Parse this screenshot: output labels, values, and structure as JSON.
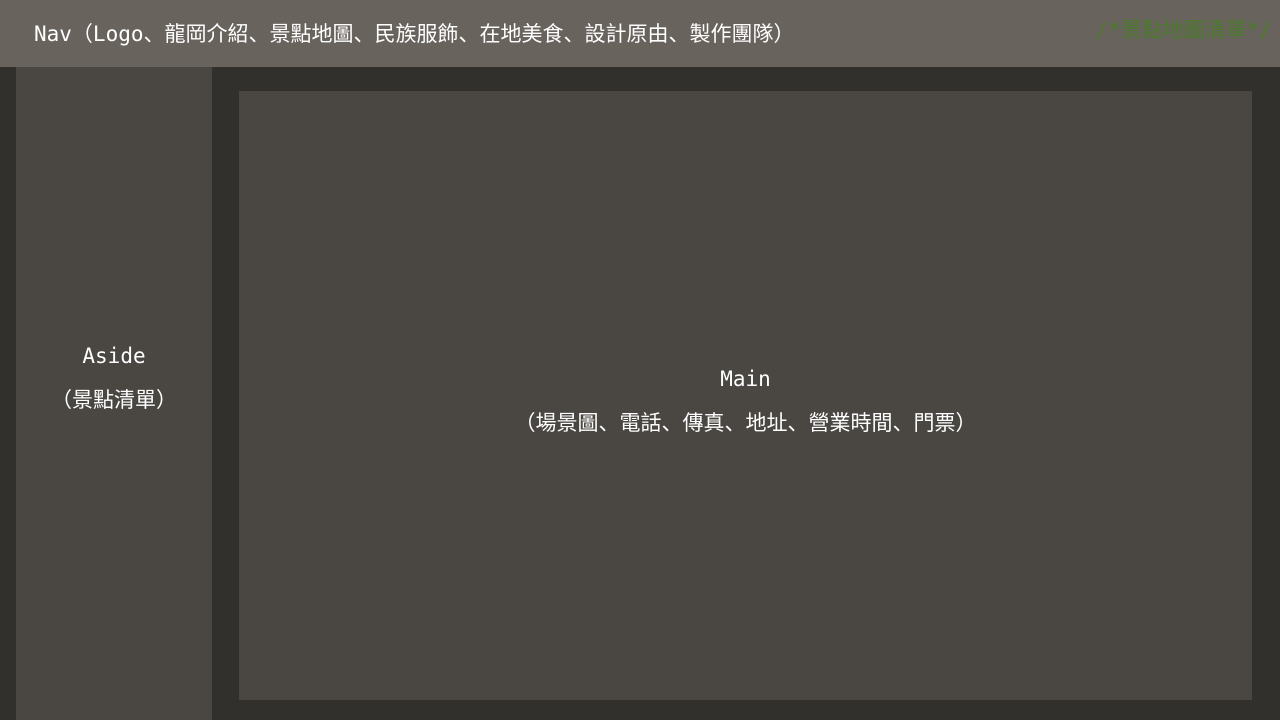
{
  "nav": {
    "label": "Nav（Logo、龍岡介紹、景點地圖、民族服飾、在地美食、設計原由、製作團隊）",
    "comment": "/*景點地圖清單*/"
  },
  "aside": {
    "title": "Aside",
    "subtitle": "（景點清單）"
  },
  "main": {
    "title": "Main",
    "subtitle": "（場景圖、電話、傳真、地址、營業時間、門票）"
  },
  "colors": {
    "background": "#32302c",
    "nav_background": "#68635d",
    "panel_background": "#4a4743",
    "text": "#ffffff",
    "comment_text": "#4c7a2c"
  }
}
